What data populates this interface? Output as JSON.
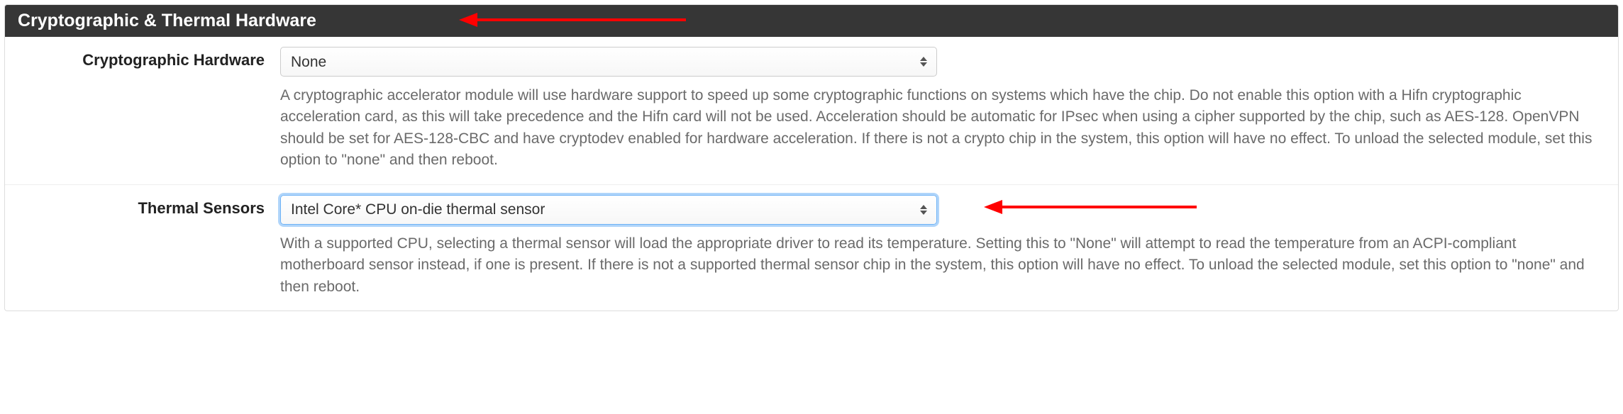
{
  "panel": {
    "title": "Cryptographic & Thermal Hardware"
  },
  "crypto": {
    "label": "Cryptographic Hardware",
    "selected": "None",
    "help": "A cryptographic accelerator module will use hardware support to speed up some cryptographic functions on systems which have the chip. Do not enable this option with a Hifn cryptographic acceleration card, as this will take precedence and the Hifn card will not be used. Acceleration should be automatic for IPsec when using a cipher supported by the chip, such as AES-128. OpenVPN should be set for AES-128-CBC and have cryptodev enabled for hardware acceleration. If there is not a crypto chip in the system, this option will have no effect. To unload the selected module, set this option to \"none\" and then reboot."
  },
  "thermal": {
    "label": "Thermal Sensors",
    "selected": "Intel Core* CPU on-die thermal sensor",
    "help": "With a supported CPU, selecting a thermal sensor will load the appropriate driver to read its temperature. Setting this to \"None\" will attempt to read the temperature from an ACPI-compliant motherboard sensor instead, if one is present. If there is not a supported thermal sensor chip in the system, this option will have no effect. To unload the selected module, set this option to \"none\" and then reboot."
  },
  "annotations": {
    "arrow_color": "#ff0000"
  }
}
